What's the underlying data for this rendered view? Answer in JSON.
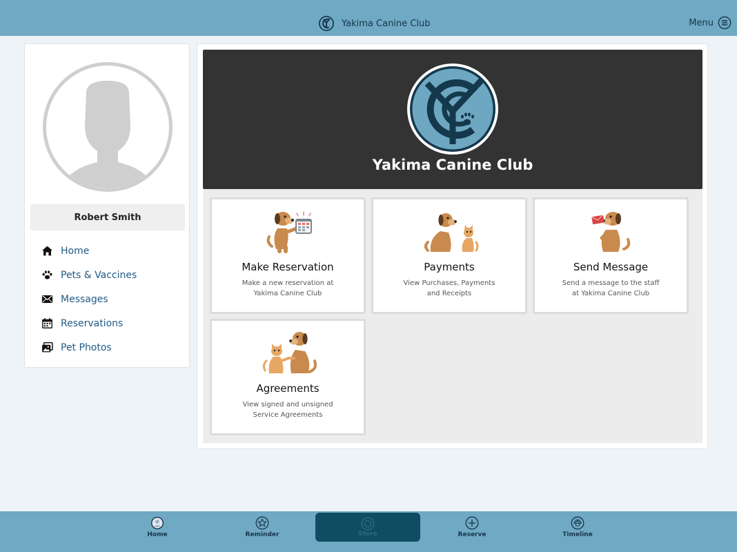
{
  "header": {
    "title": "Yakima Canine Club",
    "menu_label": "Menu",
    "logo_icon": "ycc-logo-icon",
    "menu_icon": "hamburger-circle-icon"
  },
  "profile": {
    "name": "Robert Smith",
    "avatar_icon": "person-silhouette-icon"
  },
  "nav": {
    "items": [
      {
        "label": "Home",
        "icon": "house-icon"
      },
      {
        "label": "Pets & Vaccines",
        "icon": "paw-icon"
      },
      {
        "label": "Messages",
        "icon": "envelope-icon"
      },
      {
        "label": "Reservations",
        "icon": "calendar-icon"
      },
      {
        "label": "Pet Photos",
        "icon": "photos-icon"
      }
    ]
  },
  "hero": {
    "title": "Yakima Canine Club"
  },
  "tiles": [
    {
      "title": "Make Reservation",
      "desc_line1": "Make a new reservation at",
      "desc_line2": "Yakima Canine Club",
      "icon": "dog-with-calendar-icon"
    },
    {
      "title": "Payments",
      "desc_line1": "View Purchases, Payments",
      "desc_line2": "and Receipts",
      "icon": "dog-and-puppy-icon"
    },
    {
      "title": "Send Message",
      "desc_line1": "Send a message to the staff",
      "desc_line2": "at Yakima Canine Club",
      "icon": "dog-with-letter-icon"
    },
    {
      "title": "Agreements",
      "desc_line1": "View signed and unsigned",
      "desc_line2": "Service Agreements",
      "icon": "dog-and-cat-handshake-icon"
    }
  ],
  "bottom_nav": {
    "items": [
      {
        "label": "Home",
        "icon": "avatar-circle-icon"
      },
      {
        "label": "Reminder",
        "icon": "star-circle-icon"
      },
      {
        "label": "Store",
        "icon": "store-circle-icon"
      },
      {
        "label": "Reserve",
        "icon": "plus-circle-icon"
      },
      {
        "label": "Timeline",
        "icon": "paw-circle-icon"
      }
    ]
  },
  "colors": {
    "bar": "#6fa9c3",
    "hero_bg": "#333333",
    "link": "#1f5a86",
    "active_tab": "#0f4d63",
    "logo_teal": "#6ea7c1",
    "logo_navy": "#14384c"
  }
}
